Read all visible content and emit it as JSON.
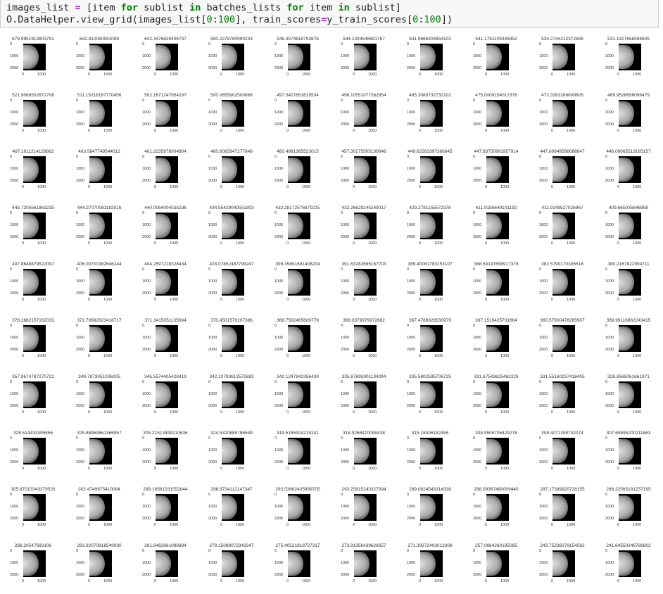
{
  "code": {
    "line1": [
      "images_list ",
      "=",
      " [item ",
      "for",
      " sublist ",
      "in",
      " batches_lists ",
      "for",
      " item ",
      "in",
      " sublist]"
    ],
    "line2": [
      "O.DataHelper.view_grid(images_list[",
      "0",
      ":",
      "100",
      "], train_scores",
      "=",
      "y_train_scores[",
      "0",
      ":",
      "100",
      "])"
    ]
  },
  "grid": {
    "axis_ticks": {
      "y": [
        "0",
        "1000",
        "2000"
      ],
      "x": [
        "0",
        "1000"
      ]
    },
    "scores": [
      "679.9951913803791",
      "642.810060591098",
      "642.3476629406737",
      "580.2278760990233",
      "546.3574618793876",
      "544.1029546691767",
      "541.9666304654103",
      "541.1751109346952",
      "534.2744212372696",
      "531.1427656598605",
      "521.9066552672708",
      "511.15218167770456",
      "502.1671247954297",
      "500.0655902500866",
      "497.5427651619534",
      "496.10551077262854",
      "495.3080732732102",
      "475.0009154012376",
      "472.3393266609805",
      "469.9528656096479",
      "467.1911214129862",
      "463.5847749544012",
      "461.2235878904804",
      "460.6065947277848",
      "460.4981365523015",
      "457.30275505130646",
      "449.62283397366645",
      "447.63750991957914",
      "447.60649598088847",
      "446.09065519185157",
      "445.7205561863235",
      "444.27070081182916",
      "440.0084004535236",
      "434.55429040551803",
      "432.28172576870215",
      "432.26629245249017",
      "429.2781155572378",
      "411.9186649101192",
      "411.9149527026967",
      "409.665035646958",
      "407.8648879522097",
      "406.00700382646244",
      "404.2597218328434",
      "403.07852487799247",
      "399.35891691408204",
      "391.63282695167703",
      "389.40081783153107",
      "388.53197699917376",
      "382.5790170306518",
      "380.2167822994711",
      "378.2882157162033",
      "372.79992823416717",
      "371.3415051135694",
      "370.4501570207386",
      "368.7502465606779",
      "368.0379979972682",
      "367.4789328530979",
      "367.1516425731664",
      "360.57900478265907",
      "359.99116862243415",
      "357.8674787270721",
      "349.7873051006005",
      "345.5574405428419",
      "342.10793613572683",
      "342.1247842356430",
      "335.87695901134094",
      "335.5802595706725",
      "331.67543625462326",
      "331.55160237418405",
      "328.8565061661971",
      "328.514433395856",
      "325.88969861366957",
      "325.21513499210636",
      "324.5320885786549",
      "319.5185904219241",
      "318.9268420099438",
      "315.18406152455",
      "308.9505706429278",
      "308.4071398732074",
      "307.69895200211863",
      "305.87013343379526",
      "302.4749975410084",
      "299.16561531552844",
      "298.9734112147347",
      "293.53662405999705",
      "293.25815243327094",
      "289.0824543314338",
      "288.09367480009440",
      "287.17399920728155",
      "286.32565181257195",
      "286.20547693106",
      "283.92070818549090",
      "281.9462661096894",
      "279.15088072343347",
      "275.40521818727317",
      "273.91356439626657",
      "271.39372403013306",
      "257.0664260195085",
      "243.75236079154562",
      "241.64550346766802"
    ]
  }
}
